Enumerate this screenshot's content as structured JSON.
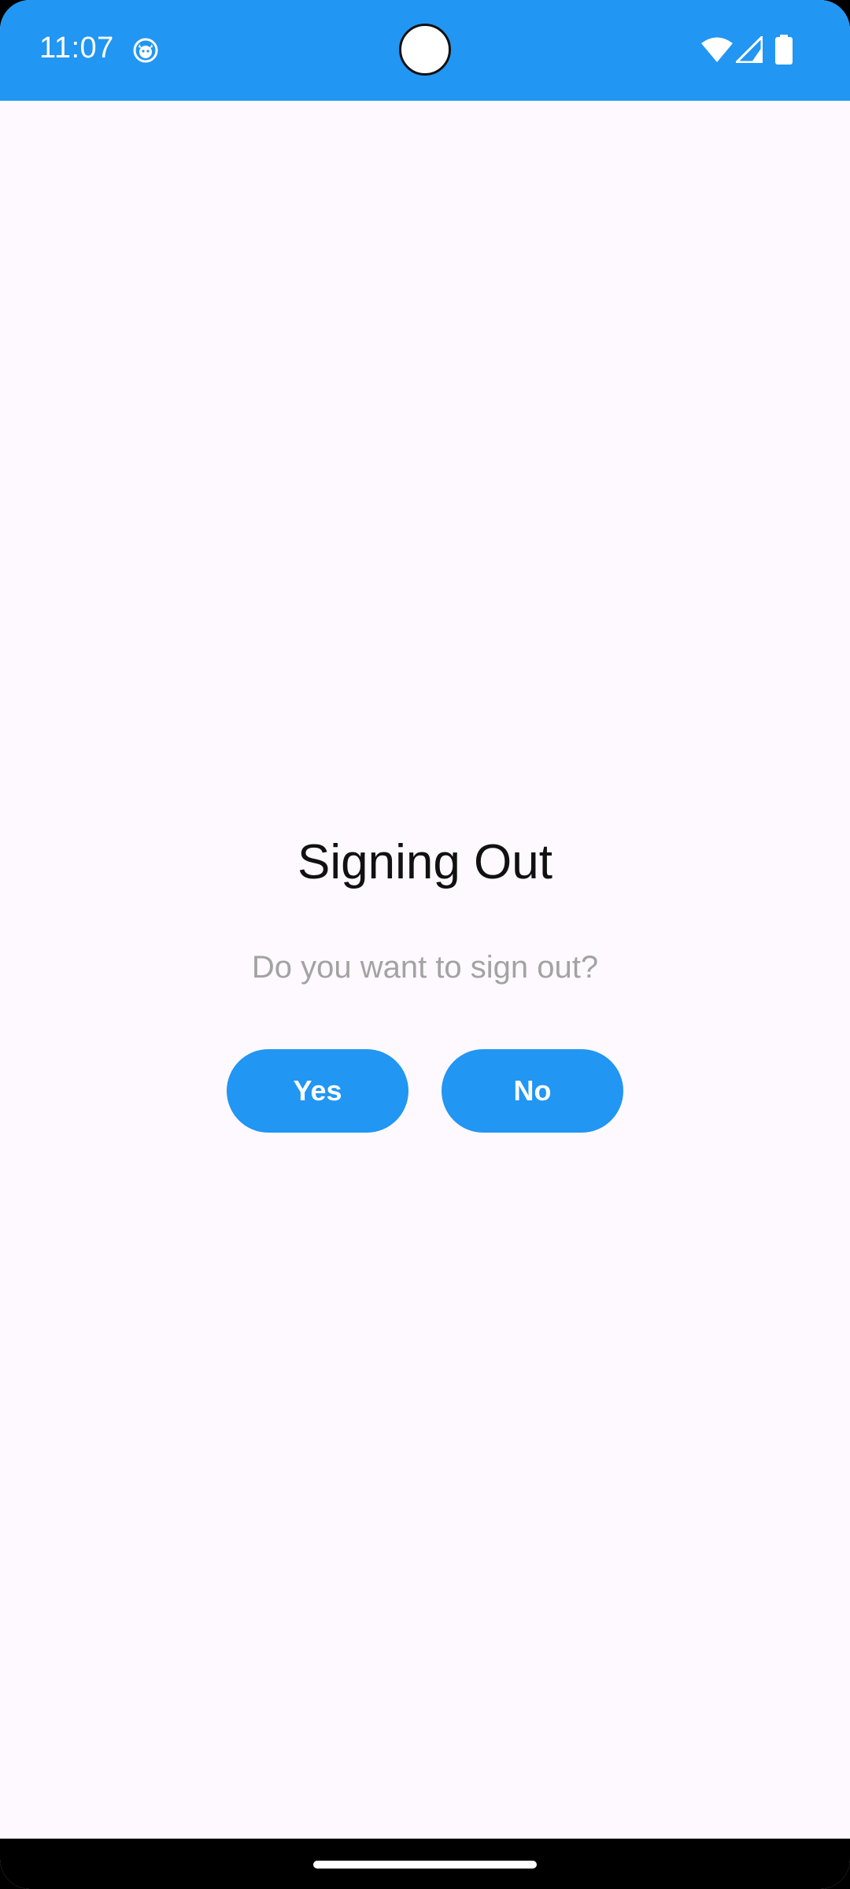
{
  "status_bar": {
    "time": "11:07",
    "background_color": "#2196F3",
    "icons": [
      "app-notification-icon",
      "wifi-icon",
      "cell-signal-icon",
      "battery-icon"
    ]
  },
  "dialog": {
    "title": "Signing Out",
    "message": "Do you want to sign out?",
    "yes_label": "Yes",
    "no_label": "No",
    "button_color": "#2196F3"
  },
  "colors": {
    "page_background": "#FEF9FE",
    "title_text": "#111111",
    "message_text": "#A3A3A3",
    "nav_bar": "#000000"
  }
}
